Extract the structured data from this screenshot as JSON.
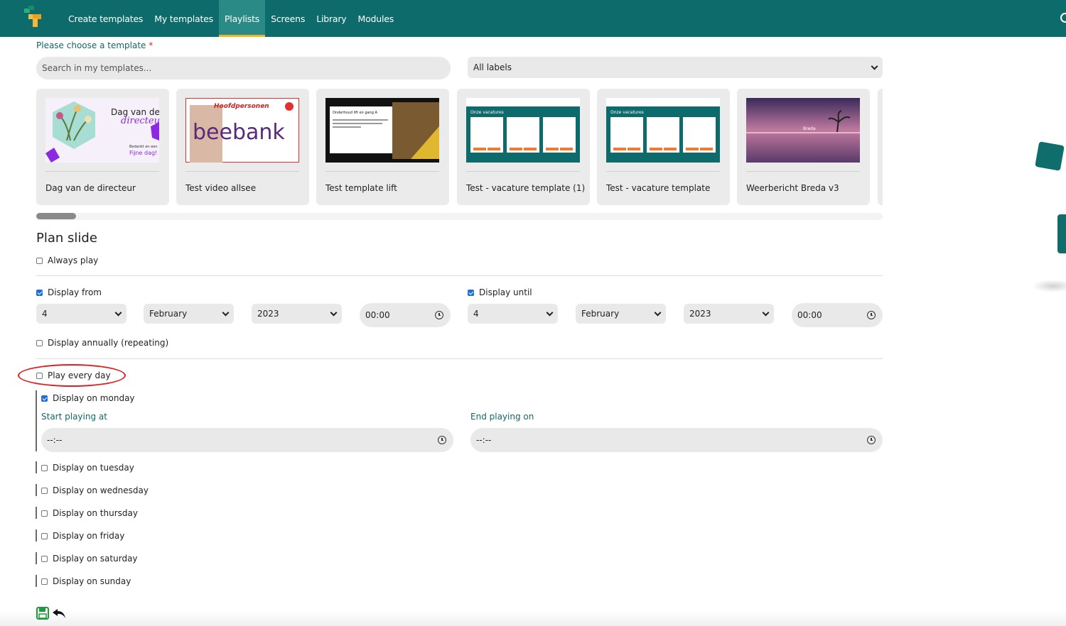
{
  "nav": {
    "items": [
      {
        "label": "Create templates",
        "active": false
      },
      {
        "label": "My templates",
        "active": false
      },
      {
        "label": "Playlists",
        "active": true
      },
      {
        "label": "Screens",
        "active": false
      },
      {
        "label": "Library",
        "active": false
      },
      {
        "label": "Modules",
        "active": false
      }
    ]
  },
  "chooser": {
    "label": "Please choose a template",
    "required_mark": "*",
    "search_placeholder": "Search in my templates...",
    "label_filter": "All labels",
    "templates": [
      {
        "title": "Dag van de directeur",
        "thumb_text_1": "Dag van de",
        "thumb_text_2": "directeur",
        "thumb_text_3": "Bedankt en een",
        "thumb_text_4": "Fijne dag!"
      },
      {
        "title": "Test video allsee",
        "thumb_text_1": "Hoofdpersonen",
        "thumb_text_2": "beebank"
      },
      {
        "title": "Test template lift",
        "thumb_text_1": "Onderhoud lift en gang A"
      },
      {
        "title": "Test - vacature template (1)",
        "thumb_text_1": "Onze vacatures"
      },
      {
        "title": "Test - vacature template",
        "thumb_text_1": "Onze vacatures"
      },
      {
        "title": "Weerbericht  Breda v3",
        "thumb_text_1": "Breda"
      }
    ],
    "scroll_position": 0.0
  },
  "plan": {
    "title": "Plan slide",
    "always_play": {
      "label": "Always play",
      "checked": false
    },
    "display_from": {
      "label": "Display from",
      "checked": true,
      "day": "4",
      "month": "February",
      "year": "2023",
      "time": "00:00"
    },
    "display_until": {
      "label": "Display until",
      "checked": true,
      "day": "4",
      "month": "February",
      "year": "2023",
      "time": "00:00"
    },
    "annually": {
      "label": "Display annually (repeating)",
      "checked": false
    },
    "play_every_day": {
      "label": "Play every day",
      "checked": false
    },
    "days": [
      {
        "label": "Display on monday",
        "checked": true
      },
      {
        "label": "Display on tuesday",
        "checked": false
      },
      {
        "label": "Display on wednesday",
        "checked": false
      },
      {
        "label": "Display on thursday",
        "checked": false
      },
      {
        "label": "Display on friday",
        "checked": false
      },
      {
        "label": "Display on saturday",
        "checked": false
      },
      {
        "label": "Display on sunday",
        "checked": false
      }
    ],
    "start_playing": {
      "label": "Start playing at",
      "value": "--:--"
    },
    "end_playing": {
      "label": "End playing on",
      "value": "--:--"
    }
  },
  "colors": {
    "primary": "#0e6b6b",
    "accent": "#f0b428",
    "annotation": "#e02020",
    "checkbox": "#1f6fd6"
  }
}
